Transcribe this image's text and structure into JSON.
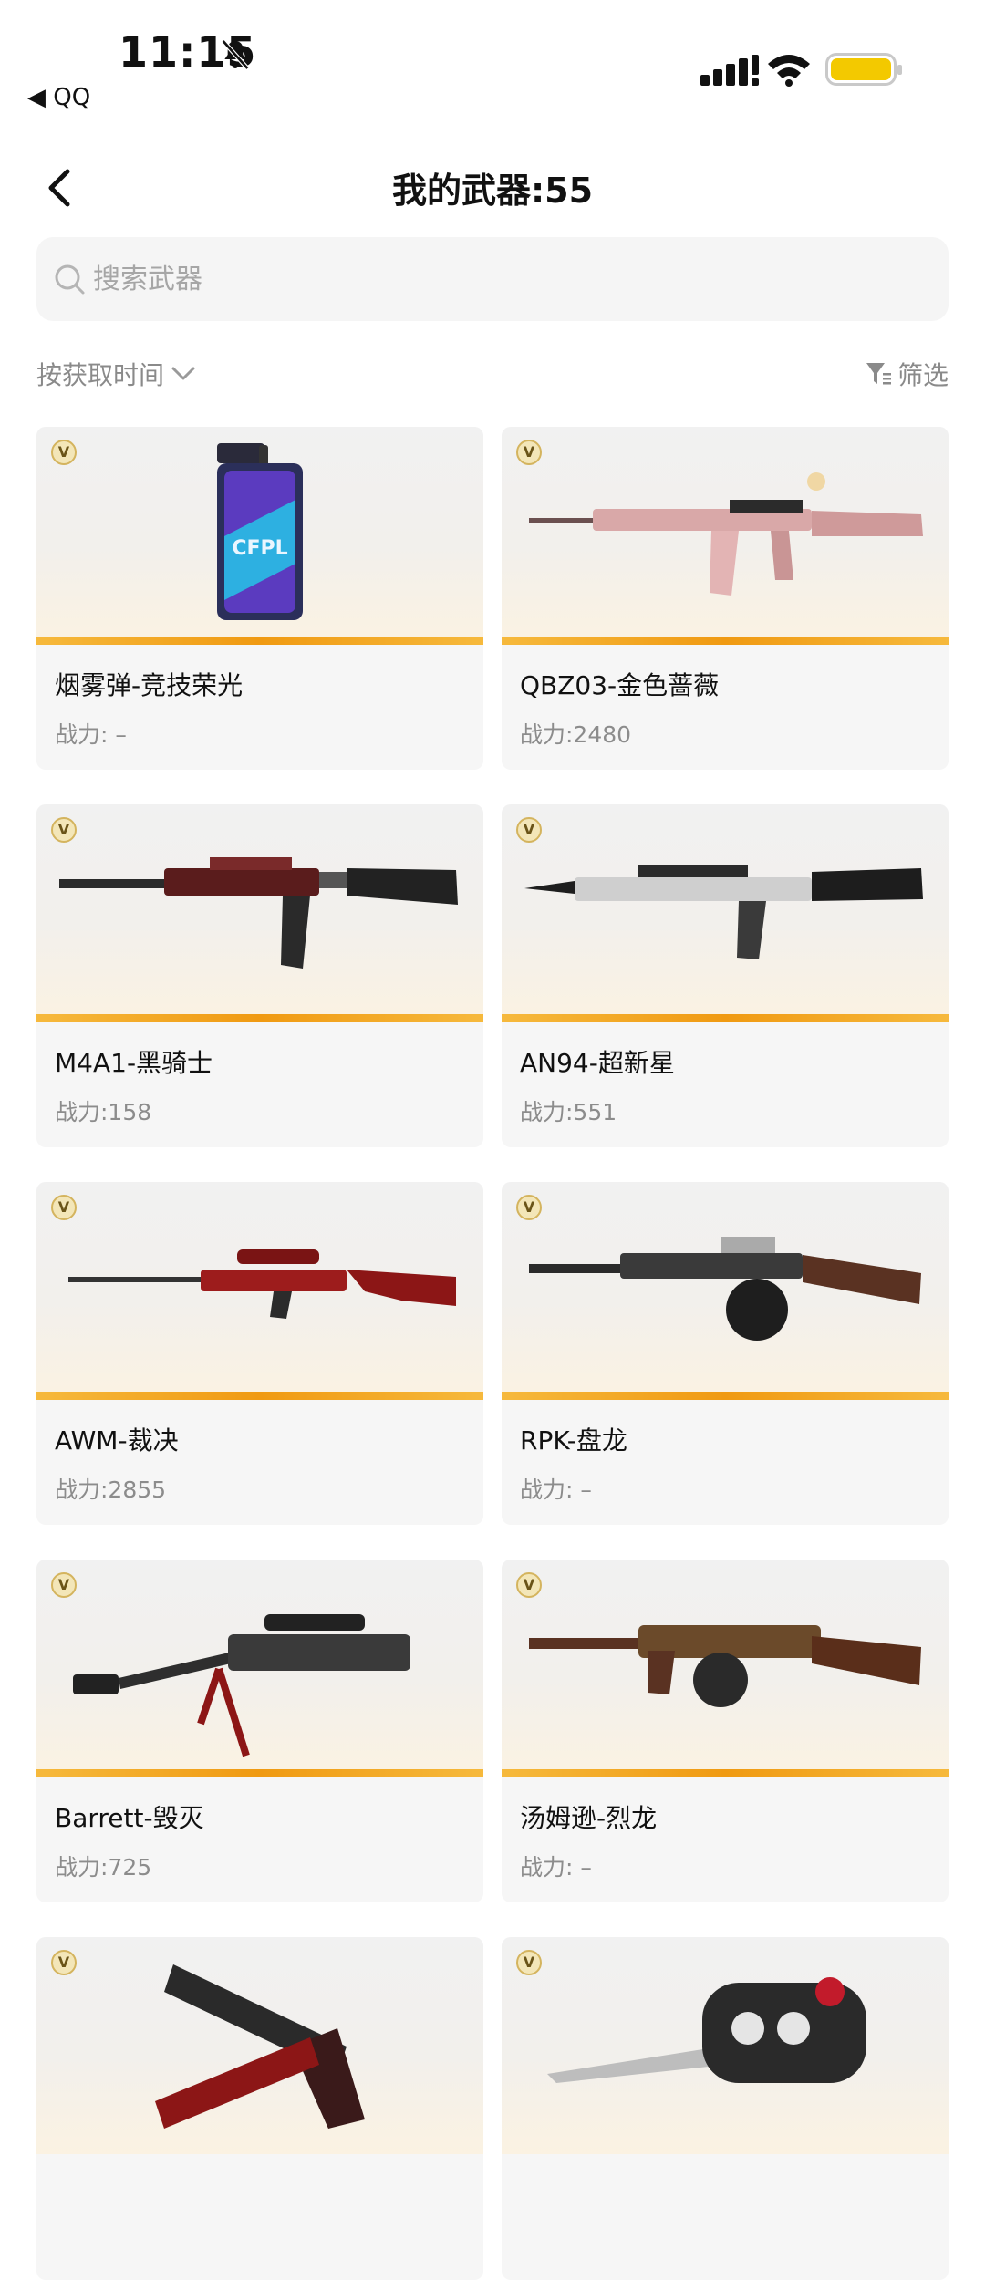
{
  "status_bar": {
    "time": "11:15",
    "back_app": "◀ QQ"
  },
  "nav": {
    "title": "我的武器:55"
  },
  "search": {
    "placeholder": "搜索武器",
    "value": ""
  },
  "sort": {
    "label": "按获取时间"
  },
  "filter": {
    "label": "筛选"
  },
  "colors": {
    "accent_bar": "#f09a12",
    "battery": "#f3c900"
  },
  "weapons": [
    {
      "name": "烟雾弹-竞技荣光",
      "power": "战力: –",
      "badge": "V",
      "icon": "smoke-grenade-icon"
    },
    {
      "name": "QBZ03-金色蔷薇",
      "power": "战力:2480",
      "badge": "V",
      "icon": "assault-rifle-icon"
    },
    {
      "name": "M4A1-黑骑士",
      "power": "战力:158",
      "badge": "V",
      "icon": "rifle-icon"
    },
    {
      "name": "AN94-超新星",
      "power": "战力:551",
      "badge": "V",
      "icon": "rifle-icon"
    },
    {
      "name": "AWM-裁决",
      "power": "战力:2855",
      "badge": "V",
      "icon": "sniper-rifle-icon"
    },
    {
      "name": "RPK-盘龙",
      "power": "战力: –",
      "badge": "V",
      "icon": "machine-gun-icon"
    },
    {
      "name": "Barrett-毁灭",
      "power": "战力:725",
      "badge": "V",
      "icon": "sniper-rifle-icon"
    },
    {
      "name": "汤姆逊-烈龙",
      "power": "战力: –",
      "badge": "V",
      "icon": "submachine-gun-icon"
    },
    {
      "name": "",
      "power": "",
      "badge": "V",
      "icon": "pistol-icon"
    },
    {
      "name": "",
      "power": "",
      "badge": "V",
      "icon": "knuckle-knife-icon"
    }
  ]
}
